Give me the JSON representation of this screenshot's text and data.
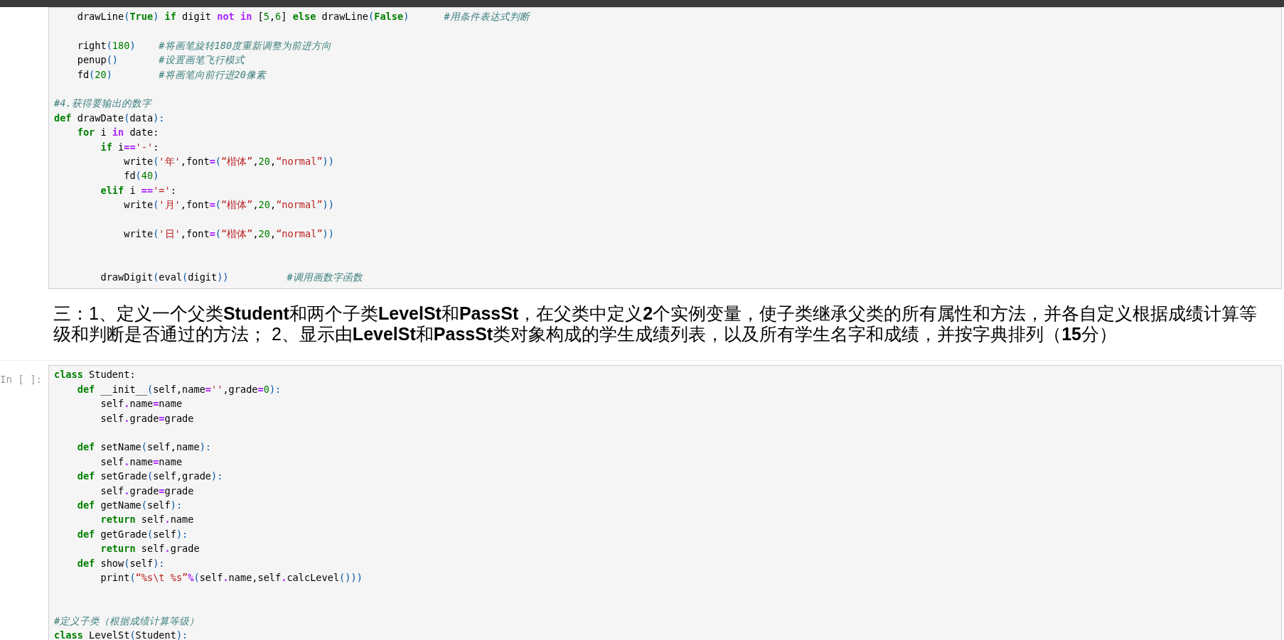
{
  "cells": [
    {
      "kind": "code",
      "lines": [
        {
          "kind": "code",
          "tokens": [
            {
              "kind": "t",
              "text": "    drawLine"
            },
            {
              "kind": "p",
              "text": "("
            },
            {
              "kind": "k",
              "text": "True"
            },
            {
              "kind": "p",
              "text": ")"
            },
            {
              "kind": "k",
              "text": " if"
            },
            {
              "kind": "t",
              "text": " digit "
            },
            {
              "kind": "o",
              "text": "not"
            },
            {
              "kind": "o",
              "text": " in"
            },
            {
              "kind": "t",
              "text": " ["
            },
            {
              "kind": "n",
              "text": "5"
            },
            {
              "kind": "t",
              "text": ","
            },
            {
              "kind": "n",
              "text": "6"
            },
            {
              "kind": "t",
              "text": "] "
            },
            {
              "kind": "k",
              "text": "else"
            },
            {
              "kind": "t",
              "text": " drawLine"
            },
            {
              "kind": "p",
              "text": "("
            },
            {
              "kind": "k",
              "text": "False"
            },
            {
              "kind": "p",
              "text": ")"
            },
            {
              "kind": "c",
              "text": "      #用条件表达式判断"
            }
          ]
        },
        {
          "kind": "blank"
        },
        {
          "kind": "code",
          "tokens": [
            {
              "kind": "t",
              "text": "    right"
            },
            {
              "kind": "p",
              "text": "("
            },
            {
              "kind": "n",
              "text": "180"
            },
            {
              "kind": "p",
              "text": ")"
            },
            {
              "kind": "c",
              "text": "    #将画笔旋转180度重新调整为前进方向"
            }
          ]
        },
        {
          "kind": "code",
          "tokens": [
            {
              "kind": "t",
              "text": "    penup"
            },
            {
              "kind": "p",
              "text": "()"
            },
            {
              "kind": "c",
              "text": "       #设置画笔飞行模式"
            }
          ]
        },
        {
          "kind": "code",
          "tokens": [
            {
              "kind": "t",
              "text": "    fd"
            },
            {
              "kind": "p",
              "text": "("
            },
            {
              "kind": "n",
              "text": "20"
            },
            {
              "kind": "p",
              "text": ")"
            },
            {
              "kind": "c",
              "text": "        #将画笔向前行进20像素"
            }
          ]
        },
        {
          "kind": "blank"
        },
        {
          "kind": "code",
          "tokens": [
            {
              "kind": "c",
              "text": "#4.获得要输出的数字"
            }
          ]
        },
        {
          "kind": "code",
          "tokens": [
            {
              "kind": "k",
              "text": "def"
            },
            {
              "kind": "t",
              "text": " drawDate"
            },
            {
              "kind": "p",
              "text": "("
            },
            {
              "kind": "t",
              "text": "data"
            },
            {
              "kind": "p",
              "text": "):"
            }
          ]
        },
        {
          "kind": "code",
          "tokens": [
            {
              "kind": "k",
              "text": "    for"
            },
            {
              "kind": "t",
              "text": " i "
            },
            {
              "kind": "o",
              "text": "in"
            },
            {
              "kind": "t",
              "text": " date:"
            }
          ]
        },
        {
          "kind": "code",
          "tokens": [
            {
              "kind": "k",
              "text": "        if"
            },
            {
              "kind": "t",
              "text": " i"
            },
            {
              "kind": "o",
              "text": "=="
            },
            {
              "kind": "s",
              "text": "'-'"
            },
            {
              "kind": "t",
              "text": ":"
            }
          ]
        },
        {
          "kind": "code",
          "tokens": [
            {
              "kind": "t",
              "text": "            write"
            },
            {
              "kind": "p",
              "text": "("
            },
            {
              "kind": "s",
              "text": "'年'"
            },
            {
              "kind": "t",
              "text": ",font"
            },
            {
              "kind": "o",
              "text": "="
            },
            {
              "kind": "p",
              "text": "("
            },
            {
              "kind": "s",
              "text": "“楷体”"
            },
            {
              "kind": "t",
              "text": ","
            },
            {
              "kind": "n",
              "text": "20"
            },
            {
              "kind": "t",
              "text": ","
            },
            {
              "kind": "s",
              "text": "“normal”"
            },
            {
              "kind": "p",
              "text": "))"
            }
          ]
        },
        {
          "kind": "code",
          "tokens": [
            {
              "kind": "t",
              "text": "            fd"
            },
            {
              "kind": "p",
              "text": "("
            },
            {
              "kind": "n",
              "text": "40"
            },
            {
              "kind": "p",
              "text": ")"
            }
          ]
        },
        {
          "kind": "code",
          "tokens": [
            {
              "kind": "k",
              "text": "        elif"
            },
            {
              "kind": "t",
              "text": " i "
            },
            {
              "kind": "o",
              "text": "=="
            },
            {
              "kind": "s",
              "text": "'='"
            },
            {
              "kind": "t",
              "text": ":"
            }
          ]
        },
        {
          "kind": "code",
          "tokens": [
            {
              "kind": "t",
              "text": "            write"
            },
            {
              "kind": "p",
              "text": "("
            },
            {
              "kind": "s",
              "text": "'月'"
            },
            {
              "kind": "t",
              "text": ",font"
            },
            {
              "kind": "o",
              "text": "="
            },
            {
              "kind": "p",
              "text": "("
            },
            {
              "kind": "s",
              "text": "“楷体”"
            },
            {
              "kind": "t",
              "text": ","
            },
            {
              "kind": "n",
              "text": "20"
            },
            {
              "kind": "t",
              "text": ","
            },
            {
              "kind": "s",
              "text": "“normal”"
            },
            {
              "kind": "p",
              "text": "))"
            }
          ]
        },
        {
          "kind": "blank"
        },
        {
          "kind": "code",
          "tokens": [
            {
              "kind": "t",
              "text": "            write"
            },
            {
              "kind": "p",
              "text": "("
            },
            {
              "kind": "s",
              "text": "'日'"
            },
            {
              "kind": "t",
              "text": ",font"
            },
            {
              "kind": "o",
              "text": "="
            },
            {
              "kind": "p",
              "text": "("
            },
            {
              "kind": "s",
              "text": "“楷体”"
            },
            {
              "kind": "t",
              "text": ","
            },
            {
              "kind": "n",
              "text": "20"
            },
            {
              "kind": "t",
              "text": ","
            },
            {
              "kind": "s",
              "text": "“normal”"
            },
            {
              "kind": "p",
              "text": "))"
            }
          ]
        },
        {
          "kind": "blank"
        },
        {
          "kind": "blank"
        },
        {
          "kind": "code",
          "tokens": [
            {
              "kind": "t",
              "text": "        drawDigit"
            },
            {
              "kind": "p",
              "text": "("
            },
            {
              "kind": "t",
              "text": "eval"
            },
            {
              "kind": "p",
              "text": "("
            },
            {
              "kind": "t",
              "text": "digit"
            },
            {
              "kind": "p",
              "text": "))"
            },
            {
              "kind": "c",
              "text": "          #调用画数字函数"
            }
          ]
        }
      ]
    },
    {
      "kind": "markdown",
      "text": "三：1、定义一个父类**Student**和两个子类**LevelSt**和**PassSt**，在父类中定义**2**个实例变量，使子类继承父类的所有属性和方法，并各自定义根据成绩计算等级和判断是否通过的方法； 2、显示由**LevelSt**和**PassSt**类对象构成的学生成绩列表，以及所有学生名字和成绩，并按字典排列（**15**分）"
    },
    {
      "kind": "code",
      "prompt": "In [ ]:",
      "lines": [
        {
          "kind": "code",
          "tokens": [
            {
              "kind": "k",
              "text": "class"
            },
            {
              "kind": "t",
              "text": " Student:"
            }
          ]
        },
        {
          "kind": "code",
          "tokens": [
            {
              "kind": "k",
              "text": "    def"
            },
            {
              "kind": "t",
              "text": " __init__"
            },
            {
              "kind": "p",
              "text": "("
            },
            {
              "kind": "t",
              "text": "self,name"
            },
            {
              "kind": "o",
              "text": "="
            },
            {
              "kind": "s",
              "text": "''"
            },
            {
              "kind": "t",
              "text": ",grade"
            },
            {
              "kind": "o",
              "text": "="
            },
            {
              "kind": "n",
              "text": "0"
            },
            {
              "kind": "p",
              "text": "):"
            }
          ]
        },
        {
          "kind": "code",
          "tokens": [
            {
              "kind": "t",
              "text": "        self"
            },
            {
              "kind": "o",
              "text": "."
            },
            {
              "kind": "t",
              "text": "name"
            },
            {
              "kind": "o",
              "text": "="
            },
            {
              "kind": "t",
              "text": "name"
            }
          ]
        },
        {
          "kind": "code",
          "tokens": [
            {
              "kind": "t",
              "text": "        self"
            },
            {
              "kind": "o",
              "text": "."
            },
            {
              "kind": "t",
              "text": "grade"
            },
            {
              "kind": "o",
              "text": "="
            },
            {
              "kind": "t",
              "text": "grade"
            }
          ]
        },
        {
          "kind": "blank"
        },
        {
          "kind": "code",
          "tokens": [
            {
              "kind": "k",
              "text": "    def"
            },
            {
              "kind": "t",
              "text": " setName"
            },
            {
              "kind": "p",
              "text": "("
            },
            {
              "kind": "t",
              "text": "self,name"
            },
            {
              "kind": "p",
              "text": "):"
            }
          ]
        },
        {
          "kind": "code",
          "tokens": [
            {
              "kind": "t",
              "text": "        self"
            },
            {
              "kind": "o",
              "text": "."
            },
            {
              "kind": "t",
              "text": "name"
            },
            {
              "kind": "o",
              "text": "="
            },
            {
              "kind": "t",
              "text": "name"
            }
          ]
        },
        {
          "kind": "code",
          "tokens": [
            {
              "kind": "k",
              "text": "    def"
            },
            {
              "kind": "t",
              "text": " setGrade"
            },
            {
              "kind": "p",
              "text": "("
            },
            {
              "kind": "t",
              "text": "self,grade"
            },
            {
              "kind": "p",
              "text": "):"
            }
          ]
        },
        {
          "kind": "code",
          "tokens": [
            {
              "kind": "t",
              "text": "        self"
            },
            {
              "kind": "o",
              "text": "."
            },
            {
              "kind": "t",
              "text": "grade"
            },
            {
              "kind": "o",
              "text": "="
            },
            {
              "kind": "t",
              "text": "grade"
            }
          ]
        },
        {
          "kind": "code",
          "tokens": [
            {
              "kind": "k",
              "text": "    def"
            },
            {
              "kind": "t",
              "text": " getName"
            },
            {
              "kind": "p",
              "text": "("
            },
            {
              "kind": "t",
              "text": "self"
            },
            {
              "kind": "p",
              "text": "):"
            }
          ]
        },
        {
          "kind": "code",
          "tokens": [
            {
              "kind": "k",
              "text": "        return"
            },
            {
              "kind": "t",
              "text": " self"
            },
            {
              "kind": "o",
              "text": "."
            },
            {
              "kind": "t",
              "text": "name"
            }
          ]
        },
        {
          "kind": "code",
          "tokens": [
            {
              "kind": "k",
              "text": "    def"
            },
            {
              "kind": "t",
              "text": " getGrade"
            },
            {
              "kind": "p",
              "text": "("
            },
            {
              "kind": "t",
              "text": "self"
            },
            {
              "kind": "p",
              "text": "):"
            }
          ]
        },
        {
          "kind": "code",
          "tokens": [
            {
              "kind": "k",
              "text": "        return"
            },
            {
              "kind": "t",
              "text": " self"
            },
            {
              "kind": "o",
              "text": "."
            },
            {
              "kind": "t",
              "text": "grade"
            }
          ]
        },
        {
          "kind": "code",
          "tokens": [
            {
              "kind": "k",
              "text": "    def"
            },
            {
              "kind": "t",
              "text": " show"
            },
            {
              "kind": "p",
              "text": "("
            },
            {
              "kind": "t",
              "text": "self"
            },
            {
              "kind": "p",
              "text": "):"
            }
          ]
        },
        {
          "kind": "code",
          "tokens": [
            {
              "kind": "t",
              "text": "        print"
            },
            {
              "kind": "p",
              "text": "("
            },
            {
              "kind": "s",
              "text": "“%s\\t %s”"
            },
            {
              "kind": "o",
              "text": "%"
            },
            {
              "kind": "p",
              "text": "("
            },
            {
              "kind": "t",
              "text": "self"
            },
            {
              "kind": "o",
              "text": "."
            },
            {
              "kind": "t",
              "text": "name,self"
            },
            {
              "kind": "o",
              "text": "."
            },
            {
              "kind": "t",
              "text": "calcLevel"
            },
            {
              "kind": "p",
              "text": "()))"
            }
          ]
        },
        {
          "kind": "blank"
        },
        {
          "kind": "blank"
        },
        {
          "kind": "code",
          "tokens": [
            {
              "kind": "c",
              "text": "#定义子类（根据成绩计算等级）"
            }
          ]
        },
        {
          "kind": "code",
          "tokens": [
            {
              "kind": "k",
              "text": "class"
            },
            {
              "kind": "t",
              "text": " LevelSt"
            },
            {
              "kind": "p",
              "text": "("
            },
            {
              "kind": "t",
              "text": "Student"
            },
            {
              "kind": "p",
              "text": "):"
            }
          ]
        }
      ]
    }
  ]
}
